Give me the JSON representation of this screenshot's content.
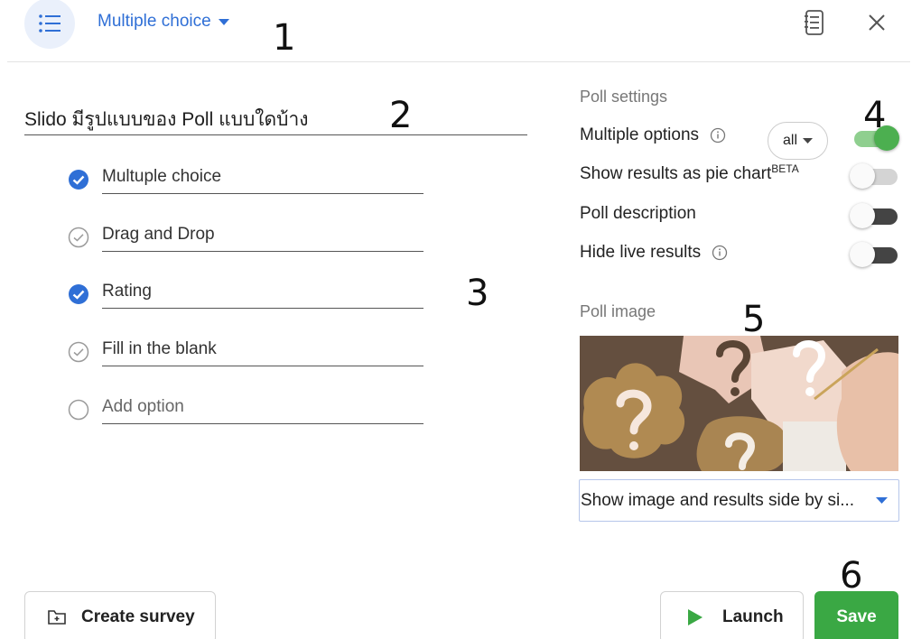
{
  "header": {
    "question_type": "Multiple choice",
    "icons": {
      "type_icon": "list-icon",
      "notes_icon": "notes-icon",
      "close_icon": "close-icon"
    }
  },
  "annotations": [
    "1",
    "2",
    "3",
    "4",
    "5",
    "6"
  ],
  "question": {
    "text": "Slido มีรูปแบบของ Poll แบบใดบ้าง"
  },
  "options": [
    {
      "label": "Multuple choice",
      "state": "correct"
    },
    {
      "label": "Drag and Drop",
      "state": "unmarked"
    },
    {
      "label": "Rating",
      "state": "correct"
    },
    {
      "label": "Fill in the blank",
      "state": "unmarked"
    }
  ],
  "add_option": {
    "placeholder": "Add option"
  },
  "settings": {
    "title": "Poll settings",
    "multiple_options": {
      "label": "Multiple options",
      "select_value": "all",
      "on": true
    },
    "pie_chart": {
      "label": "Show results as pie chart",
      "badge": "BETA",
      "on": false
    },
    "description": {
      "label": "Poll description",
      "on": false
    },
    "hide_results": {
      "label": "Hide live results",
      "on": false
    }
  },
  "image_section": {
    "title": "Poll image",
    "display_option": "Show image and results side by si..."
  },
  "footer": {
    "create_survey": "Create survey",
    "launch": "Launch",
    "save": "Save"
  },
  "colors": {
    "accent_blue": "#2f6fd6",
    "toggle_on": "#4caf50",
    "save_green": "#3aa844"
  }
}
